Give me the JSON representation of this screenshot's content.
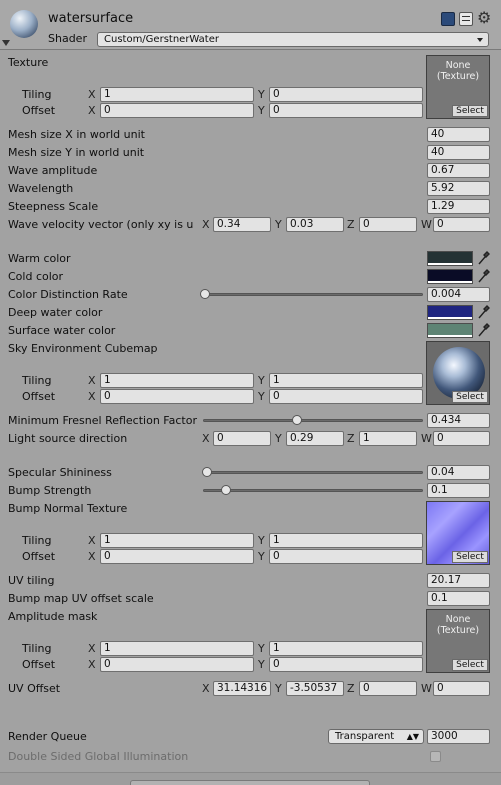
{
  "header": {
    "material_name": "watersurface",
    "shader_label": "Shader",
    "shader_value": "Custom/GerstnerWater"
  },
  "labels": {
    "tiling": "Tiling",
    "offset": "Offset",
    "x": "X",
    "y": "Y",
    "z": "Z",
    "w": "W",
    "none_line1": "None",
    "none_line2": "(Texture)",
    "select": "Select"
  },
  "texture": {
    "label": "Texture",
    "tiling_x": "1",
    "tiling_y": "0",
    "offset_x": "0",
    "offset_y": "0"
  },
  "props": {
    "mesh_x": {
      "label": "Mesh size X in world unit",
      "value": "40"
    },
    "mesh_y": {
      "label": "Mesh size Y in world unit",
      "value": "40"
    },
    "wave_amp": {
      "label": "Wave amplitude",
      "value": "0.67"
    },
    "wavelength": {
      "label": "Wavelength",
      "value": "5.92"
    },
    "steepness": {
      "label": "Steepness Scale",
      "value": "1.29"
    },
    "wave_vel": {
      "label": "Wave velocity vector (only xy is u",
      "x": "0.34",
      "y": "0.03",
      "z": "0",
      "w": "0"
    },
    "warm": {
      "label": "Warm color",
      "color": "#243234"
    },
    "cold": {
      "label": "Cold color",
      "color": "#0a0c26"
    },
    "distinction": {
      "label": "Color Distinction Rate",
      "value": "0.004",
      "fraction": 0.0
    },
    "deep": {
      "label": "Deep water color",
      "color": "#1f2580"
    },
    "surface": {
      "label": "Surface water color",
      "color": "#5e8474"
    },
    "sky_cubemap": {
      "label": "Sky Environment Cubemap",
      "tiling_x": "1",
      "tiling_y": "1",
      "offset_x": "0",
      "offset_y": "0"
    },
    "fresnel": {
      "label": "Minimum Fresnel Reflection Factor",
      "value": "0.434",
      "fraction": 0.434
    },
    "light_dir": {
      "label": "Light source direction",
      "x": "0",
      "y": "0.29",
      "z": "1",
      "w": "0"
    },
    "specular": {
      "label": "Specular Shininess",
      "value": "0.04",
      "fraction": 0.01
    },
    "bump_strength": {
      "label": "Bump Strength",
      "value": "0.1",
      "fraction": 0.1
    },
    "bump_tex": {
      "label": "Bump Normal Texture",
      "tiling_x": "1",
      "tiling_y": "1",
      "offset_x": "0",
      "offset_y": "0"
    },
    "uv_tiling": {
      "label": "UV tiling",
      "value": "20.17"
    },
    "bump_uv": {
      "label": "Bump map UV offset scale",
      "value": "0.1"
    },
    "amp_mask": {
      "label": "Amplitude mask",
      "tiling_x": "1",
      "tiling_y": "1",
      "offset_x": "0",
      "offset_y": "0"
    },
    "uv_offset": {
      "label": "UV Offset",
      "x": "31.14316",
      "y": "-3.50537",
      "z": "0",
      "w": "0"
    },
    "render_queue": {
      "label": "Render Queue",
      "dropdown": "Transparent",
      "value": "3000"
    },
    "double_sided": {
      "label": "Double Sided Global Illumination"
    }
  }
}
